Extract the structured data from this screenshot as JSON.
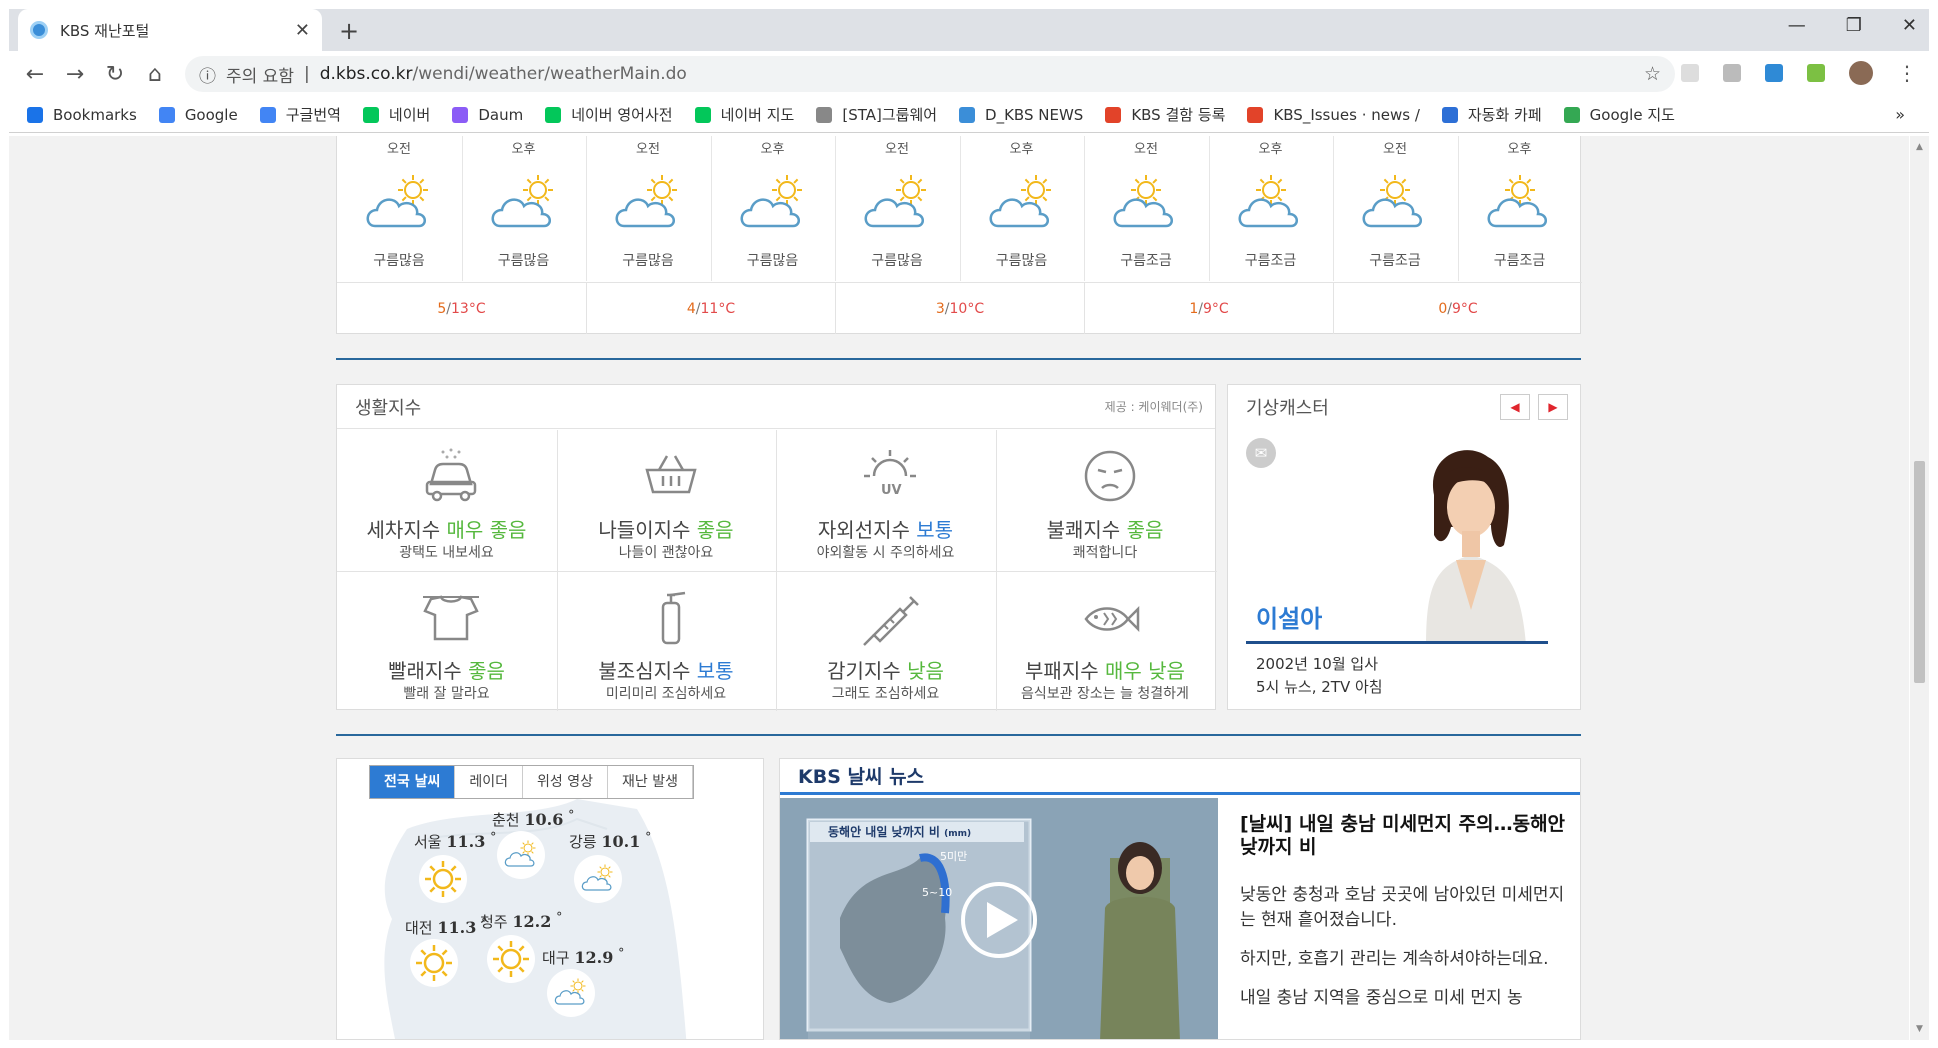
{
  "browser": {
    "tab_title": "KBS 재난포털",
    "url_warning": "주의 요함",
    "url_host": "d.kbs.co.kr",
    "url_path": "/wendi/weather/weatherMain.do",
    "bookmarks": [
      {
        "label": "Bookmarks",
        "color": "#1a73e8"
      },
      {
        "label": "Google",
        "color": "#4285f4"
      },
      {
        "label": "구글번역",
        "color": "#4285f4"
      },
      {
        "label": "네이버",
        "color": "#03c75a"
      },
      {
        "label": "Daum",
        "color": "#8b5cf6"
      },
      {
        "label": "네이버 영어사전",
        "color": "#03c75a"
      },
      {
        "label": "네이버 지도",
        "color": "#03c75a"
      },
      {
        "label": "[STA]그룹웨어",
        "color": "#888888"
      },
      {
        "label": "D_KBS NEWS",
        "color": "#3b8ed8"
      },
      {
        "label": "KBS 결함 등록",
        "color": "#e24329"
      },
      {
        "label": "KBS_Issues · news /",
        "color": "#e24329"
      },
      {
        "label": "자동화 카페",
        "color": "#2d6fd6"
      },
      {
        "label": "Google 지도",
        "color": "#34a853"
      }
    ],
    "more": "»"
  },
  "forecast": {
    "periods": [
      {
        "ampm": "오전",
        "desc": "구름많음",
        "icon": "mostly-cloudy-icon"
      },
      {
        "ampm": "오후",
        "desc": "구름많음",
        "icon": "mostly-cloudy-icon"
      },
      {
        "ampm": "오전",
        "desc": "구름많음",
        "icon": "mostly-cloudy-icon"
      },
      {
        "ampm": "오후",
        "desc": "구름많음",
        "icon": "mostly-cloudy-icon"
      },
      {
        "ampm": "오전",
        "desc": "구름많음",
        "icon": "mostly-cloudy-icon"
      },
      {
        "ampm": "오후",
        "desc": "구름많음",
        "icon": "mostly-cloudy-icon"
      },
      {
        "ampm": "오전",
        "desc": "구름조금",
        "icon": "partly-cloudy-icon"
      },
      {
        "ampm": "오후",
        "desc": "구름조금",
        "icon": "partly-cloudy-icon"
      },
      {
        "ampm": "오전",
        "desc": "구름조금",
        "icon": "partly-cloudy-icon"
      },
      {
        "ampm": "오후",
        "desc": "구름조금",
        "icon": "partly-cloudy-icon"
      }
    ],
    "temps": [
      {
        "low": "5",
        "high": "13°C"
      },
      {
        "low": "4",
        "high": "11°C"
      },
      {
        "low": "3",
        "high": "10°C"
      },
      {
        "low": "1",
        "high": "9°C"
      },
      {
        "low": "0",
        "high": "9°C"
      }
    ]
  },
  "life_index": {
    "title": "생활지수",
    "source": "제공 : 케이웨더(주)",
    "items": [
      {
        "name": "세차지수",
        "level": "매우 좋음",
        "level_color": "green",
        "tip": "광택도 내보세요",
        "icon": "car-wash-icon"
      },
      {
        "name": "나들이지수",
        "level": "좋음",
        "level_color": "green",
        "tip": "나들이 괜찮아요",
        "icon": "basket-icon"
      },
      {
        "name": "자외선지수",
        "level": "보통",
        "level_color": "blue",
        "tip": "야외활동 시 주의하세요",
        "icon": "uv-sun-icon"
      },
      {
        "name": "불쾌지수",
        "level": "좋음",
        "level_color": "green",
        "tip": "쾌적합니다",
        "icon": "face-icon"
      },
      {
        "name": "빨래지수",
        "level": "좋음",
        "level_color": "green",
        "tip": "빨래 잘 말라요",
        "icon": "laundry-shirt-icon"
      },
      {
        "name": "불조심지수",
        "level": "보통",
        "level_color": "blue",
        "tip": "미리미리 조심하세요",
        "icon": "fire-extinguisher-icon"
      },
      {
        "name": "감기지수",
        "level": "낮음",
        "level_color": "green",
        "tip": "그래도 조심하세요",
        "icon": "syringe-icon"
      },
      {
        "name": "부패지수",
        "level": "매우 낮음",
        "level_color": "green",
        "tip": "음식보관 장소는 늘 청결하게",
        "icon": "fish-icon"
      }
    ]
  },
  "caster": {
    "title": "기상캐스터",
    "name": "이설아",
    "info1": "2002년 10월 입사",
    "info2": "5시 뉴스, 2TV 아침"
  },
  "map": {
    "tabs": [
      "전국 날씨",
      "레이더",
      "위성 영상",
      "재난 발생"
    ],
    "cities": [
      {
        "name": "춘천",
        "temp": "10.6",
        "unit": "°"
      },
      {
        "name": "서울",
        "temp": "11.3",
        "unit": "°"
      },
      {
        "name": "강릉",
        "temp": "10.1",
        "unit": "°"
      },
      {
        "name": "대전",
        "temp": "11.3",
        "unit": "°"
      },
      {
        "name": "청주",
        "temp": "12.2",
        "unit": "°"
      },
      {
        "name": "대구",
        "temp": "12.9",
        "unit": "°"
      }
    ]
  },
  "news": {
    "title": "KBS 날씨 뉴스",
    "video_caption": "동해안 내일 낮까지 비",
    "video_unit": "(mm)",
    "video_label_a": "5미만",
    "video_label_b": "5~10",
    "headline": "[날씨] 내일 충남 미세먼지 주의…동해안 낮까지 비",
    "para1": "낮동안 충청과 호남 곳곳에 남아있던 미세먼지는 현재 흩어졌습니다.",
    "para2": "하지만, 호흡기 관리는 계속하셔야하는데요.",
    "para3": "내일 충남 지역을 중심으로 미세 먼지 농"
  }
}
